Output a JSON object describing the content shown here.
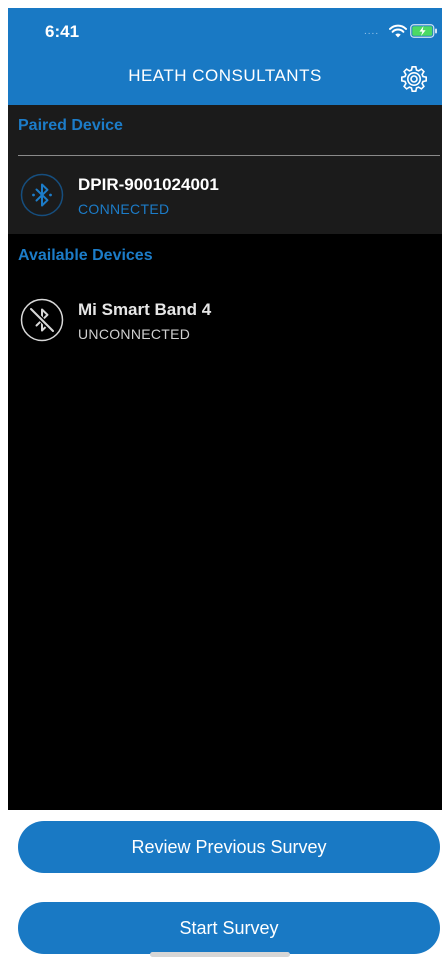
{
  "status_bar": {
    "time": "6:41",
    "signal": "....",
    "wifi_icon": "wifi-icon",
    "battery_icon": "battery-charging-icon"
  },
  "header": {
    "title": "HEATH CONSULTANTS",
    "settings_icon": "gear-icon",
    "background_color": "#1979c4"
  },
  "paired_section": {
    "title": "Paired Device",
    "devices": [
      {
        "name": "DPIR-9001024001",
        "status": "CONNECTED",
        "status_color": "#1c7cc8",
        "icon": "bluetooth-icon"
      }
    ]
  },
  "available_section": {
    "title": "Available Devices",
    "devices": [
      {
        "name": "Mi Smart Band 4",
        "status": "UNCONNECTED",
        "status_color": "#d0d0d0",
        "icon": "bluetooth-disabled-icon"
      }
    ]
  },
  "buttons": {
    "review_label": "Review Previous Survey",
    "start_label": "Start Survey"
  },
  "colors": {
    "accent": "#1979c4",
    "list_background": "#000000",
    "paired_background": "#1b1b1b"
  }
}
